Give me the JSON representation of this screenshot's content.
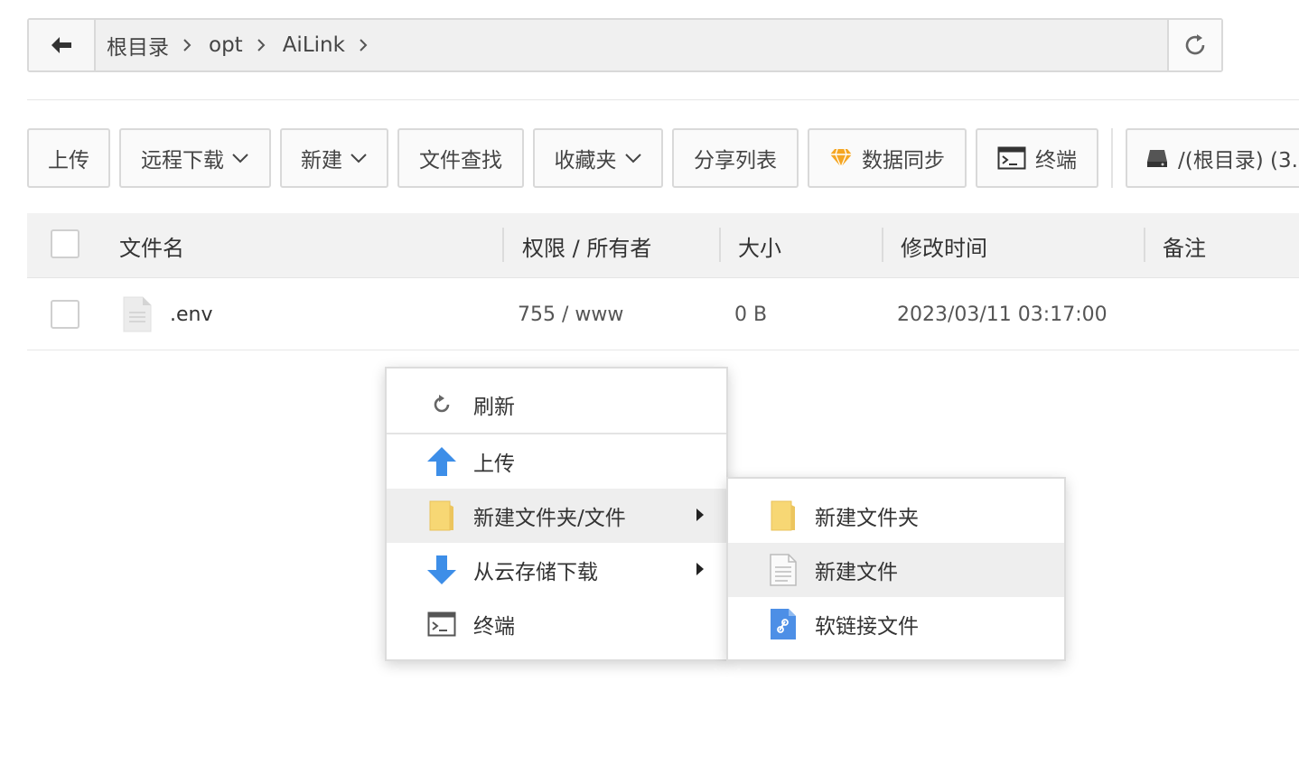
{
  "breadcrumb": {
    "items": [
      "根目录",
      "opt",
      "AiLink"
    ]
  },
  "toolbar": {
    "upload": "上传",
    "remote_download": "远程下载",
    "new": "新建",
    "file_search": "文件查找",
    "favorites": "收藏夹",
    "share_list": "分享列表",
    "data_sync": "数据同步",
    "terminal": "终端",
    "disk": "/(根目录) (3."
  },
  "table": {
    "columns": [
      "文件名",
      "权限 / 所有者",
      "大小",
      "修改时间",
      "备注"
    ],
    "rows": [
      {
        "name": ".env",
        "perm": "755 / www",
        "size": "0 B",
        "mtime": "2023/03/11 03:17:00",
        "note": ""
      }
    ]
  },
  "context_menu": {
    "items": [
      "刷新",
      "上传",
      "新建文件夹/文件",
      "从云存储下载",
      "终端"
    ]
  },
  "submenu": {
    "items": [
      "新建文件夹",
      "新建文件",
      "软链接文件"
    ]
  },
  "colors": {
    "accent_blue": "#3d8ee8",
    "folder_yellow": "#f7d774",
    "diamond_orange": "#f5a623"
  }
}
